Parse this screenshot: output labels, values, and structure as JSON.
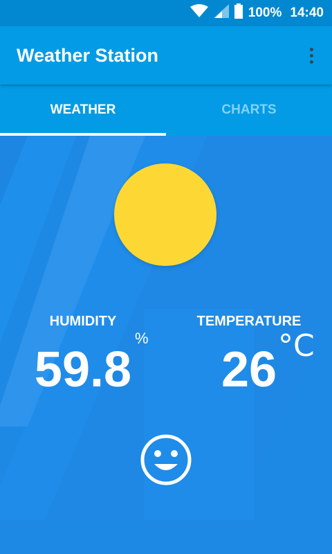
{
  "status_bar": {
    "battery_percent": "100%",
    "time": "14:40",
    "icons": [
      "wifi-icon",
      "signal-icon",
      "battery-icon"
    ]
  },
  "app_bar": {
    "title": "Weather Station",
    "menu_icon": "overflow-menu-icon"
  },
  "tabs": [
    {
      "label": "WEATHER",
      "active": true
    },
    {
      "label": "CHARTS",
      "active": false
    }
  ],
  "weather": {
    "condition_icon": "sun-icon",
    "humidity": {
      "label": "HUMIDITY",
      "value": "59.8",
      "unit": "%"
    },
    "temperature": {
      "label": "TEMPERATURE",
      "value": "26",
      "unit": "°C"
    },
    "comfort_icon": "smiley-face-icon"
  },
  "colors": {
    "status_bar": "#0288D1",
    "app_bar": "#039BE5",
    "background": "#1E88E5",
    "sun": "#FDD835",
    "inactive_tab": "#81D4FA"
  }
}
